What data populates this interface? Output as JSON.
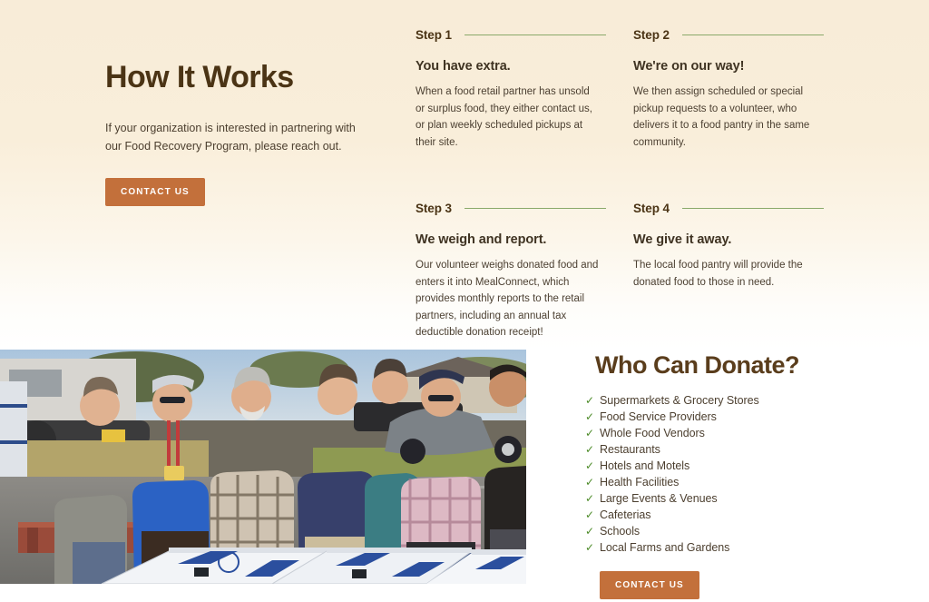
{
  "intro": {
    "title": "How It Works",
    "body": "If your organization is interested in partnering with our Food Recovery Program, please reach out.",
    "cta_label": "CONTACT US"
  },
  "steps": [
    {
      "label": "Step 1",
      "title": "You have extra.",
      "body": "When a food retail partner has unsold or surplus food, they either contact us, or plan weekly scheduled pickups at their site."
    },
    {
      "label": "Step 2",
      "title": "We're on our way!",
      "body": "We then assign scheduled or special pickup requests to a volunteer, who delivers it to a food pantry in the same community."
    },
    {
      "label": "Step 3",
      "title": "We weigh and report.",
      "body": "Our volunteer weighs donated food and enters it into MealConnect, which provides monthly reports to the retail partners, including an annual tax deductible donation receipt!"
    },
    {
      "label": "Step 4",
      "title": "We give it away.",
      "body": "The local food pantry will provide the donated food to those in need."
    }
  ],
  "photo": {
    "alt": "Group of volunteers standing behind pallets of boxed food donations outdoors"
  },
  "donate": {
    "title": "Who Can Donate?",
    "check_icon": "✓",
    "items": [
      "Supermarkets & Grocery Stores",
      "Food Service Providers",
      "Whole Food Vendors",
      "Restaurants",
      "Hotels and Motels",
      "Health Facilities",
      "Large Events & Venues",
      "Cafeterias",
      "Schools",
      "Local Farms and Gardens"
    ],
    "cta_label": "CONTACT US"
  },
  "colors": {
    "background_top": "#f8ecd8",
    "background_bottom": "#ffffff",
    "heading": "#4b3415",
    "donate_heading": "#5a3d1c",
    "body_text": "#4c3f2f",
    "accent_button": "#c3703b",
    "rule_green": "#8aa96a",
    "check_green": "#4c8a27"
  }
}
